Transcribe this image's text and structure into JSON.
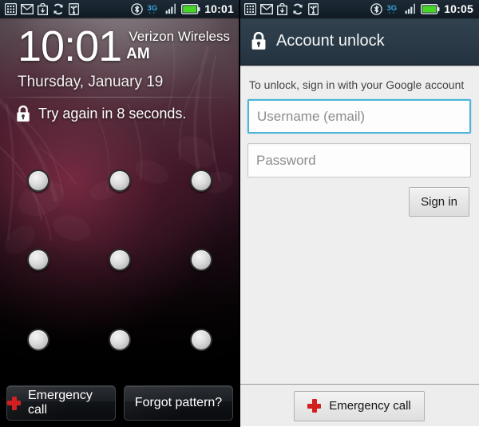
{
  "left_screen": {
    "name": "android-lock-screen-pattern",
    "statusbar": {
      "time": "10:01",
      "icons_left": [
        "keypad-icon",
        "gmail-envelope-icon",
        "download-bag-icon",
        "sync-icon",
        "usb-icon"
      ],
      "icons_right": [
        "bluetooth-icon",
        "3g-icon",
        "signal-bars-icon",
        "battery-icon"
      ],
      "network_label": "3G",
      "battery_color": "#49d42a",
      "network_color": "#3aa5e0"
    },
    "clock": {
      "time": "10:01",
      "ampm": "AM",
      "date": "Thursday, January 19"
    },
    "carrier": "Verizon Wireless",
    "status_message": {
      "icon": "lock-icon",
      "text": "Try again in 8 seconds."
    },
    "pattern_grid": {
      "rows": 3,
      "columns": 3,
      "dot_count": 9,
      "dot_state": "unselected"
    },
    "buttons": {
      "emergency_call": "Emergency call",
      "forgot_pattern": "Forgot pattern?",
      "emergency_icon": "red-cross-icon",
      "emergency_icon_color": "#d21f1f"
    }
  },
  "right_screen": {
    "name": "android-account-unlock-screen",
    "statusbar": {
      "time": "10:05",
      "icons_left": [
        "keypad-icon",
        "gmail-envelope-icon",
        "download-bag-icon",
        "sync-icon",
        "usb-icon"
      ],
      "icons_right": [
        "bluetooth-icon",
        "3g-icon",
        "signal-bars-icon",
        "battery-icon"
      ],
      "network_label": "3G",
      "battery_color": "#49d42a",
      "network_color": "#3aa5e0"
    },
    "header": {
      "icon": "lock-icon",
      "title": "Account unlock",
      "background_color": "#2b3b47"
    },
    "instruction": "To unlock, sign in with your Google account",
    "fields": {
      "username": {
        "placeholder": "Username (email)",
        "value": "",
        "focused": true,
        "focus_color": "#4ab5d8"
      },
      "password": {
        "placeholder": "Password",
        "value": "",
        "focused": false
      }
    },
    "buttons": {
      "sign_in": "Sign in",
      "emergency_call": "Emergency call",
      "emergency_icon": "red-cross-icon",
      "emergency_icon_color": "#d21f1f"
    }
  }
}
